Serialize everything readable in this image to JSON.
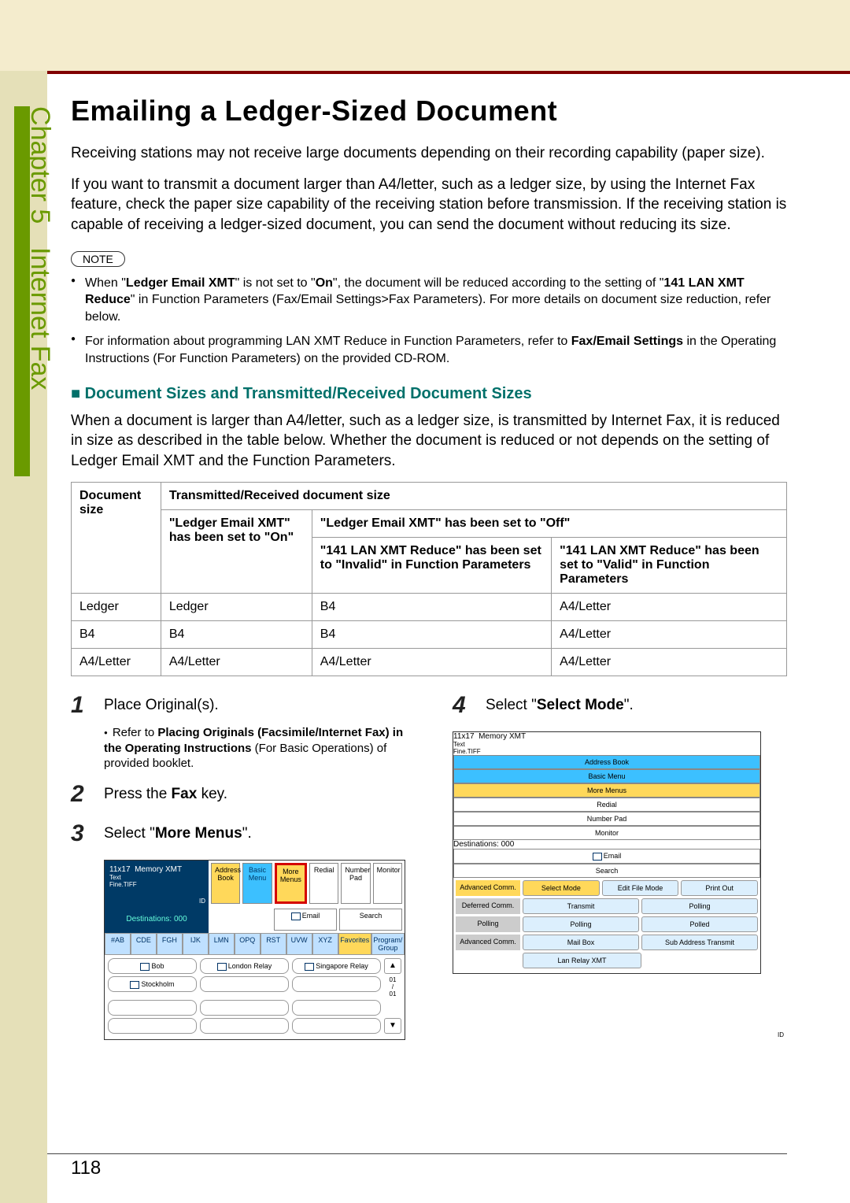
{
  "chapter": {
    "label": "Chapter 5",
    "section": "Internet Fax"
  },
  "title": "Emailing a Ledger-Sized Document",
  "para1": "Receiving stations may not receive large documents depending on their recording capability (paper size).",
  "para2": "If you want to transmit a document larger than A4/letter, such as a ledger size, by using the Internet Fax feature, check the paper size capability of the receiving station before transmission. If the receiving station is capable of receiving a ledger-sized document, you can send the document without reducing its size.",
  "noteBadge": "NOTE",
  "notes": [
    {
      "pre": "When \"",
      "b1": "Ledger Email XMT",
      "mid1": "\" is not set to \"",
      "b2": "On",
      "mid2": "\", the document will be reduced according to the setting of \"",
      "b3": "141 LAN XMT Reduce",
      "post": "\" in Function Parameters (Fax/Email Settings>Fax Parameters). For more details on document size reduction, refer below."
    },
    {
      "pre": "For information about programming LAN XMT Reduce in Function Parameters, refer to ",
      "b1": "Fax/Email Settings",
      "post": " in the Operating Instructions (For Function Parameters) on the provided CD-ROM."
    }
  ],
  "subheading": "Document Sizes and Transmitted/Received Document Sizes",
  "para3": "When a document is larger than A4/letter, such as a ledger size, is transmitted by Internet Fax, it is reduced in size as described in the table below. Whether the document is reduced or not depends on the setting of Ledger Email XMT and the Function Parameters.",
  "table": {
    "h_doc": "Document size",
    "h_trx": "Transmitted/Received document size",
    "h_on_pre": "\"",
    "h_on_b": "Ledger Email XMT",
    "h_on_mid": "\" has been set to \"",
    "h_on_b2": "On",
    "h_on_post": "\"",
    "h_off_pre": "\"",
    "h_off_b": "Ledger Email XMT",
    "h_off_mid": "\" has been set to \"",
    "h_off_b2": "Off",
    "h_off_post": "\"",
    "h_inv_pre": "\"",
    "h_inv_b": "141 LAN XMT Reduce",
    "h_inv_mid": "\" has been set to \"",
    "h_inv_b2": "Invalid",
    "h_inv_post": "\" in Function Parameters",
    "h_val_pre": "\"",
    "h_val_b": "141 LAN XMT Reduce",
    "h_val_mid": "\" has been set to \"",
    "h_val_b2": "Valid",
    "h_val_post": "\" in Function Parameters",
    "rows": [
      {
        "c0": "Ledger",
        "c1": "Ledger",
        "c2": "B4",
        "c3": "A4/Letter"
      },
      {
        "c0": "B4",
        "c1": "B4",
        "c2": "B4",
        "c3": "A4/Letter"
      },
      {
        "c0": "A4/Letter",
        "c1": "A4/Letter",
        "c2": "A4/Letter",
        "c3": "A4/Letter"
      }
    ]
  },
  "steps": {
    "s1": "Place Original(s).",
    "s1note_pre": "Refer to ",
    "s1note_b": "Placing Originals (Facsimile/Internet Fax) in the Operating Instructions",
    "s1note_post": " (For Basic Operations) of provided booklet.",
    "s2_pre": "Press the ",
    "s2_b": "Fax",
    "s2_post": " key.",
    "s3_pre": "Select \"",
    "s3_b": "More Menus",
    "s3_post": "\".",
    "s4_pre": "Select \"",
    "s4_b": "Select Mode",
    "s4_post": "\"."
  },
  "panel1": {
    "status1": "11x17",
    "status2": "Memory XMT",
    "status3": "Text",
    "status4": "Fine.TIFF",
    "status5": "ID",
    "dest": "Destinations: 000",
    "addrbook": "Address Book",
    "basicmenu": "Basic Menu",
    "moremenus": "More Menus",
    "redial": "Redial",
    "numberpad": "Number Pad",
    "monitor": "Monitor",
    "email": "Email",
    "search": "Search",
    "tabs": [
      "#AB",
      "CDE",
      "FGH",
      "IJK",
      "LMN",
      "OPQ",
      "RST",
      "UVW",
      "XYZ",
      "Favorites",
      "Program/\nGroup"
    ],
    "d_bob": "Bob",
    "d_london": "London Relay",
    "d_sing": "Singapore Relay",
    "d_stock": "Stockholm",
    "pager": "01\n/\n01"
  },
  "panel2": {
    "status1": "11x17",
    "status2": "Memory XMT",
    "status3": "Text",
    "status4": "Fine.TIFF",
    "status5": "ID",
    "dest": "Destinations: 000",
    "addrbook": "Address Book",
    "basicmenu": "Basic Menu",
    "moremenus": "More Menus",
    "redial": "Redial",
    "numberpad": "Number Pad",
    "monitor": "Monitor",
    "email": "Email",
    "search": "Search",
    "r1h": "Advanced Comm.",
    "r1a": "Select Mode",
    "r1b": "Edit File Mode",
    "r1c": "Print Out",
    "r2h": "Deferred Comm.",
    "r2a": "Transmit",
    "r2b": "Polling",
    "r3h": "Polling",
    "r3a": "Polling",
    "r3b": "Polled",
    "r4h": "Advanced Comm.",
    "r4a": "Mail Box",
    "r4b": "Sub Address Transmit",
    "r4c": "Lan Relay XMT"
  },
  "pageNumber": "118"
}
